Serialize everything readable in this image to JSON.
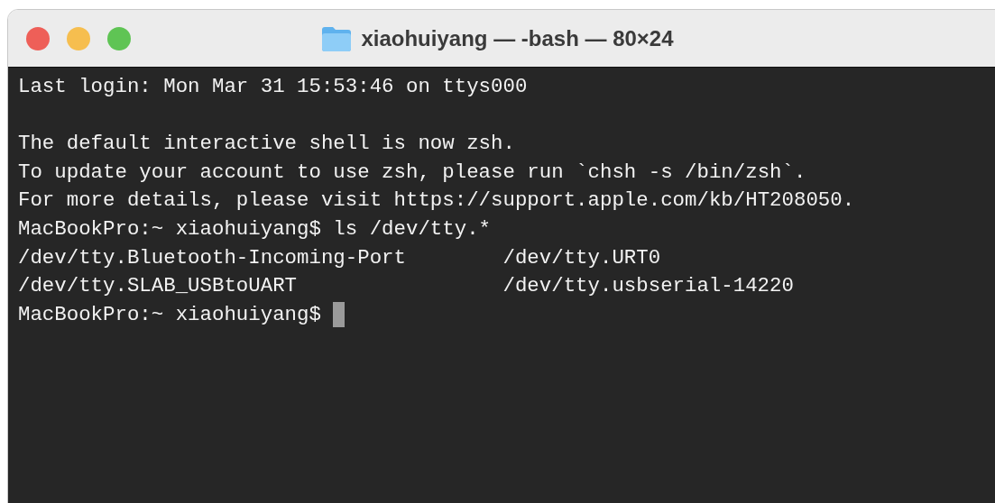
{
  "window": {
    "title": "xiaohuiyang — -bash — 80×24"
  },
  "terminal": {
    "lines": [
      {
        "kind": "text",
        "text": "Last login: Mon Mar 31 15:53:46 on ttys000"
      },
      {
        "kind": "blank"
      },
      {
        "kind": "text",
        "text": "The default interactive shell is now zsh."
      },
      {
        "kind": "text",
        "text": "To update your account to use zsh, please run `chsh -s /bin/zsh`."
      },
      {
        "kind": "text",
        "text": "For more details, please visit https://support.apple.com/kb/HT208050."
      },
      {
        "kind": "text",
        "text": "MacBookPro:~ xiaohuiyang$ ls /dev/tty.*"
      },
      {
        "kind": "columns",
        "cells": [
          "/dev/tty.Bluetooth-Incoming-Port",
          "/dev/tty.URT0"
        ]
      },
      {
        "kind": "columns",
        "cells": [
          "/dev/tty.SLAB_USBtoUART",
          "/dev/tty.usbserial-14220"
        ]
      },
      {
        "kind": "prompt",
        "text": "MacBookPro:~ xiaohuiyang$",
        "cursor": true
      }
    ]
  }
}
